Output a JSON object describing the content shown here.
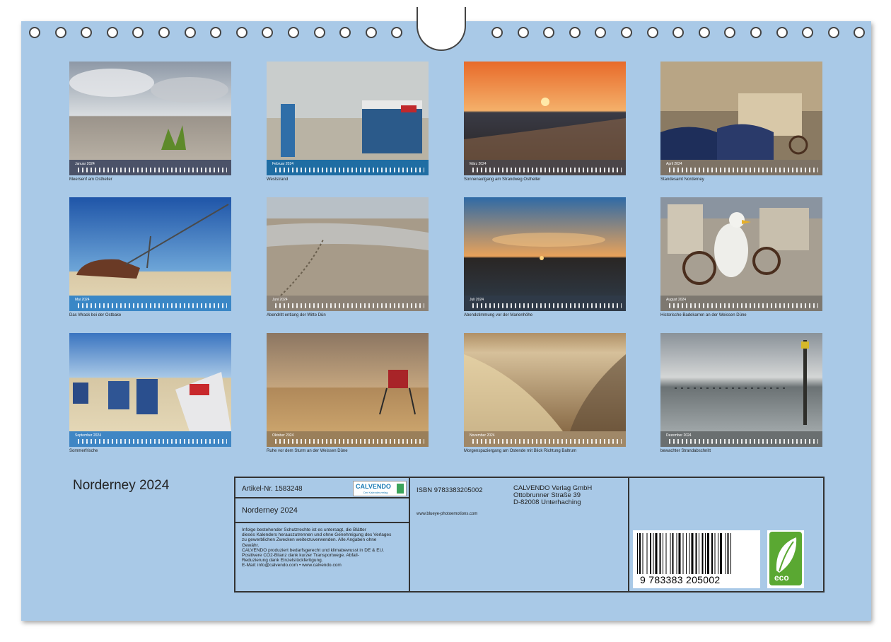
{
  "calendar": {
    "title": "Norderney 2024",
    "months": [
      {
        "label": "Januar 2024",
        "caption": "Meersenf am Ostheller",
        "band_color": "#4b5268"
      },
      {
        "label": "Februar 2024",
        "caption": "Weststrand",
        "band_color": "#1f6da3"
      },
      {
        "label": "März 2024",
        "caption": "Sonnenaufgang am Strandweg Ostheller",
        "band_color": "#4a4548"
      },
      {
        "label": "April 2024",
        "caption": "Standesamt Norderney",
        "band_color": "#7d7265"
      },
      {
        "label": "Mai 2024",
        "caption": "Das Wrack bei der Ostbake",
        "band_color": "#3a87c6"
      },
      {
        "label": "Juni 2024",
        "caption": "Abendritt entlang der Witte Dün",
        "band_color": "#8c8276"
      },
      {
        "label": "Juli 2024",
        "caption": "Abendstimmung vor der Marienhöhe",
        "band_color": "#2f3a48"
      },
      {
        "label": "August 2024",
        "caption": "Historische Badekarren an der Weissen Düne",
        "band_color": "#7d7870"
      },
      {
        "label": "September 2024",
        "caption": "Sommerfrische",
        "band_color": "#3f86c4"
      },
      {
        "label": "Oktober 2024",
        "caption": "Ruhe vor dem Sturm an der Weissen Düne",
        "band_color": "#9a7f5a"
      },
      {
        "label": "November 2024",
        "caption": "Morgenspaziergang am Ostende mit Blick Richtung Baltrum",
        "band_color": "#a08868"
      },
      {
        "label": "Dezember 2024",
        "caption": "bewachter Strandabschnitt",
        "band_color": "#6a6f70"
      }
    ]
  },
  "info": {
    "article": "Artikel-Nr. 1583248",
    "publisher_logo": "CALVENDO",
    "publisher_logo_sub": "Der Kalenderverlag",
    "product_title": "Norderney 2024",
    "legal_lines": [
      "Infolge bestehender Schutzrechte ist es untersagt, die Blätter",
      "dieses Kalenders herauszutrennen und ohne Genehmigung des Verlages",
      "zu gewerblichen Zwecken weiterzuverwenden. Alle Angaben ohne",
      "Gewähr.",
      "CALVENDO produziert bedarfsgerecht und klimabewusst in DE & EU.",
      "Positivere CO2-Bilanz dank kurzer Transportwege. Abfall-",
      "Reduzierung dank Einzelstückfertigung.",
      "E-Mail: info@calvendo.com • www.calvendo.com"
    ],
    "isbn": "ISBN 9783383205002",
    "website": "www.blueye-photoemotions.com",
    "publisher_name": "CALVENDO Verlag GmbH",
    "publisher_street": "Ottobrunner Straße 39",
    "publisher_city": "D-82008 Unterhaching",
    "barcode_number": "9   783383   205002",
    "eco_label": "eco"
  }
}
